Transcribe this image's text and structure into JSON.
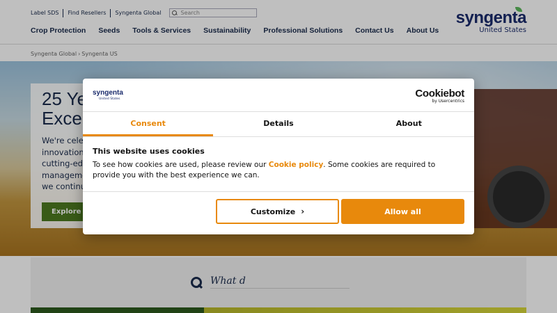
{
  "utility_links": [
    "Label SDS",
    "Find Resellers",
    "Syngenta Global"
  ],
  "search": {
    "placeholder": "Search"
  },
  "nav": [
    "Crop Protection",
    "Seeds",
    "Tools & Services",
    "Sustainability",
    "Professional Solutions",
    "Contact Us",
    "About Us"
  ],
  "logo": {
    "wordmark": "syngenta",
    "region": "United States"
  },
  "breadcrumb": [
    "Syngenta Global",
    "Syngenta US"
  ],
  "hero": {
    "title_line1": "25 Ye",
    "title_line2": "Excel",
    "text_lines": [
      "We're celeb",
      "innovation,",
      "cutting-edg",
      "manageme",
      "we continu"
    ],
    "button": "Explore th"
  },
  "site_search": {
    "prompt": "What d"
  },
  "consent": {
    "logo_wordmark": "syngenta",
    "logo_region": "United States",
    "cookiebot_name": "Cookiebot",
    "cookiebot_sub": "by Usercentrics",
    "tabs": [
      "Consent",
      "Details",
      "About"
    ],
    "title": "This website uses cookies",
    "text_before": "To see how cookies are used, please review our ",
    "policy_link": "Cookie policy",
    "text_after": ". Some cookies are required to provide you with the best experience we can.",
    "customize_label": "Customize",
    "allow_label": "Allow all"
  },
  "colors": {
    "accent": "#e8890c",
    "brand_navy": "#1a2b6c",
    "hero_button": "#4c7a20"
  }
}
